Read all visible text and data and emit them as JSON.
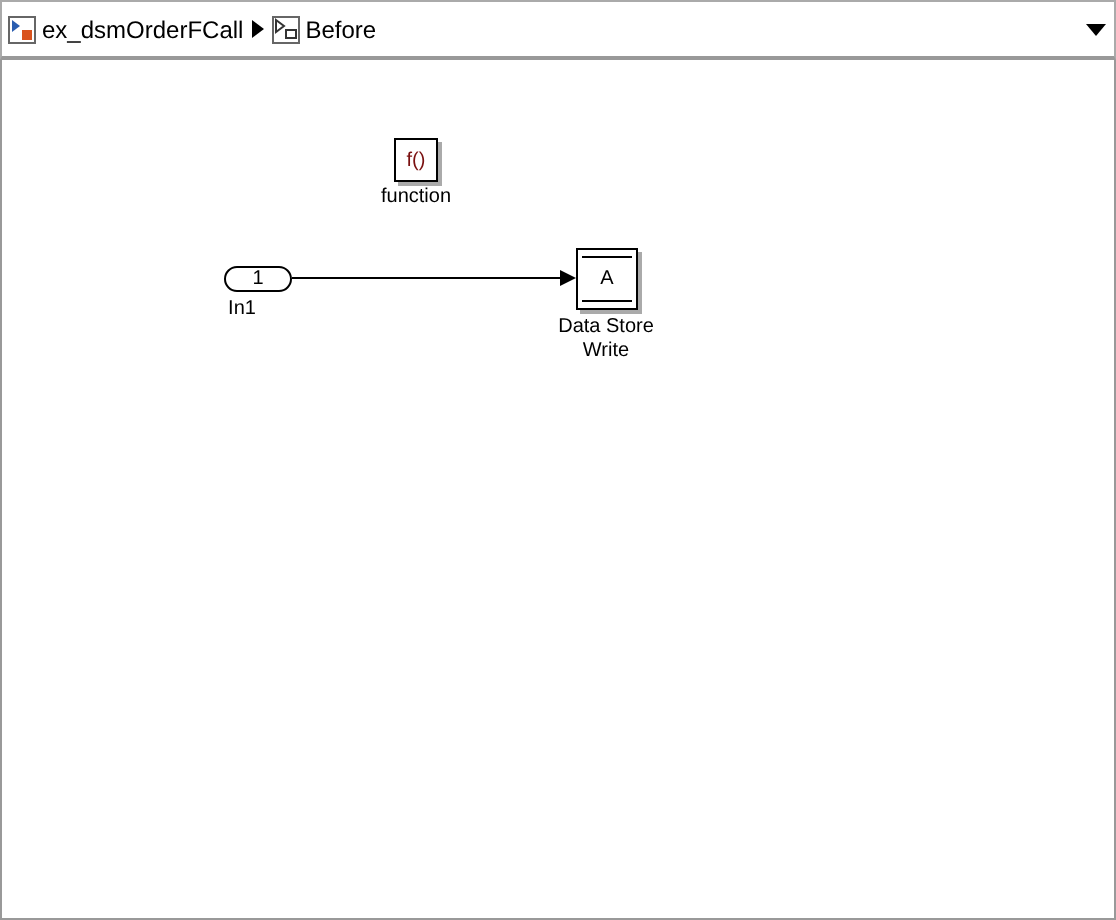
{
  "breadcrumb": [
    {
      "kind": "model",
      "label": "ex_dsmOrderFCall"
    },
    {
      "kind": "subsystem",
      "label": "Before"
    }
  ],
  "blocks": [
    {
      "kind": "function_call",
      "text": "f()",
      "label": "function"
    },
    {
      "kind": "inport",
      "text": "1",
      "label": "In1"
    },
    {
      "kind": "data_store_write",
      "text": "A",
      "label": "Data Store Write"
    }
  ]
}
